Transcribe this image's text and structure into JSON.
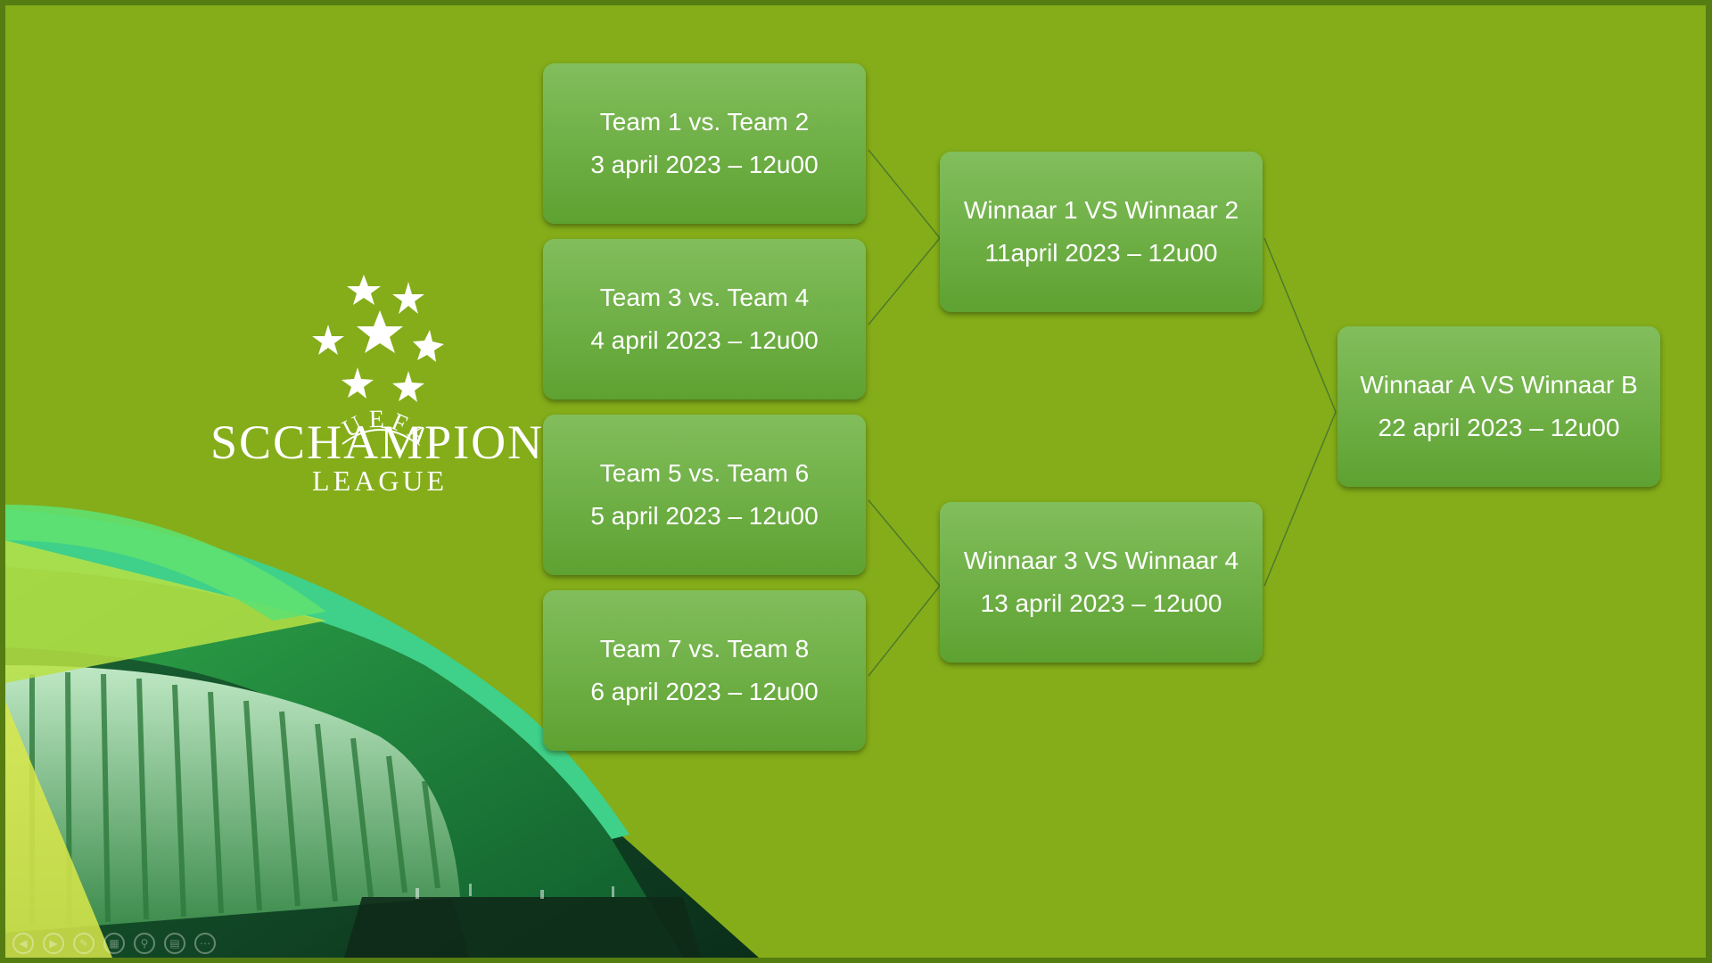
{
  "logo": {
    "emblem": "starball-logo",
    "arc_text": "UEFA",
    "title_text": "SCCHAMPIONS",
    "subtitle_text": "LEAGUE"
  },
  "bracket": {
    "round1": [
      {
        "teams": "Team 1 vs. Team 2",
        "date": "3 april 2023 – 12u00"
      },
      {
        "teams": "Team 3 vs. Team 4",
        "date": "4 april 2023 – 12u00"
      },
      {
        "teams": "Team 5 vs. Team 6",
        "date": "5 april 2023 – 12u00"
      },
      {
        "teams": "Team 7 vs. Team 8",
        "date": "6 april 2023 – 12u00"
      }
    ],
    "round2": [
      {
        "teams": "Winnaar 1 VS Winnaar 2",
        "date": "11april 2023 – 12u00"
      },
      {
        "teams": "Winnaar 3 VS Winnaar 4",
        "date": "13 april 2023 – 12u00"
      }
    ],
    "final": {
      "teams": "Winnaar A VS Winnaar B",
      "date": "22 april 2023 – 12u00"
    }
  },
  "colors": {
    "slide_background": "#84ad19",
    "box_top": "#82be5c",
    "box_bottom": "#5ea232",
    "connector": "#4f7a2a",
    "text": "#ffffff"
  },
  "controls": [
    "prev-icon",
    "next-icon",
    "pen-icon",
    "slides-icon",
    "zoom-icon",
    "subtitles-icon",
    "more-icon"
  ]
}
